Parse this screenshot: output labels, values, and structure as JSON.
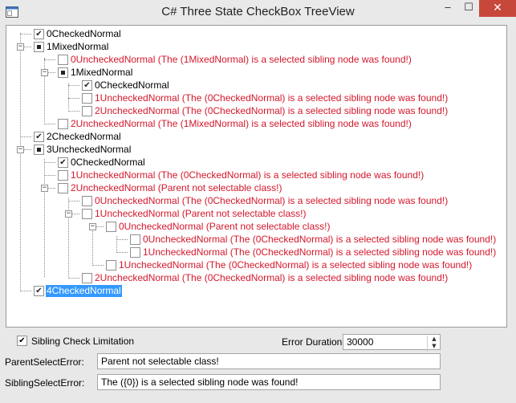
{
  "window": {
    "title": "C# Three State CheckBox TreeView",
    "icon": "app-window-icon"
  },
  "titlebar_buttons": {
    "minimize": "‒",
    "maximize": "☐",
    "close": "✕"
  },
  "tree": {
    "nodes": [
      {
        "label": "0CheckedNormal",
        "state": "checked",
        "level": 0,
        "expander": null,
        "red": false
      },
      {
        "label": "1MixedNormal",
        "state": "mixed",
        "level": 0,
        "expander": "−",
        "red": false
      },
      {
        "label": "0UncheckedNormal (The (1MixedNormal) is a selected sibling node was found!)",
        "state": "unchecked",
        "level": 1,
        "expander": null,
        "red": true
      },
      {
        "label": "1MixedNormal",
        "state": "mixed",
        "level": 1,
        "expander": "−",
        "red": false
      },
      {
        "label": "0CheckedNormal",
        "state": "checked",
        "level": 2,
        "expander": null,
        "red": false
      },
      {
        "label": "1UncheckedNormal (The (0CheckedNormal) is a selected sibling node was found!)",
        "state": "unchecked",
        "level": 2,
        "expander": null,
        "red": true
      },
      {
        "label": "2UncheckedNormal (The (0CheckedNormal) is a selected sibling node was found!)",
        "state": "unchecked",
        "level": 2,
        "expander": null,
        "red": true
      },
      {
        "label": "2UncheckedNormal (The (1MixedNormal) is a selected sibling node was found!)",
        "state": "unchecked",
        "level": 1,
        "expander": null,
        "red": true
      },
      {
        "label": "2CheckedNormal",
        "state": "checked",
        "level": 0,
        "expander": null,
        "red": false
      },
      {
        "label": "3UncheckedNormal",
        "state": "mixed",
        "level": 0,
        "expander": "−",
        "red": false
      },
      {
        "label": "0CheckedNormal",
        "state": "checked",
        "level": 1,
        "expander": null,
        "red": false
      },
      {
        "label": "1UncheckedNormal (The (0CheckedNormal) is a selected sibling node was found!)",
        "state": "unchecked",
        "level": 1,
        "expander": null,
        "red": true
      },
      {
        "label": "2UncheckedNormal (Parent not selectable class!)",
        "state": "unchecked",
        "level": 1,
        "expander": "−",
        "red": true
      },
      {
        "label": "0UncheckedNormal (The (0CheckedNormal) is a selected sibling node was found!)",
        "state": "unchecked",
        "level": 2,
        "expander": null,
        "red": true
      },
      {
        "label": "1UncheckedNormal (Parent not selectable class!)",
        "state": "unchecked",
        "level": 2,
        "expander": "−",
        "red": true
      },
      {
        "label": "0UncheckedNormal (Parent not selectable class!)",
        "state": "unchecked",
        "level": 3,
        "expander": "−",
        "red": true
      },
      {
        "label": "0UncheckedNormal (The (0CheckedNormal) is a selected sibling node was found!)",
        "state": "unchecked",
        "level": 4,
        "expander": null,
        "red": true
      },
      {
        "label": "1UncheckedNormal (The (0CheckedNormal) is a selected sibling node was found!)",
        "state": "unchecked",
        "level": 4,
        "expander": null,
        "red": true
      },
      {
        "label": "1UncheckedNormal (The (0CheckedNormal) is a selected sibling node was found!)",
        "state": "unchecked",
        "level": 3,
        "expander": null,
        "red": true
      },
      {
        "label": "2UncheckedNormal (The (0CheckedNormal) is a selected sibling node was found!)",
        "state": "unchecked",
        "level": 2,
        "expander": null,
        "red": true
      },
      {
        "label": "4CheckedNormal",
        "state": "checked",
        "level": 0,
        "expander": null,
        "red": false,
        "selected": true
      }
    ]
  },
  "controls": {
    "sibling_check_label": "Sibling Check Limitation",
    "sibling_check_checked": true,
    "error_duration_label": "Error Duration:",
    "error_duration_value": "30000",
    "parent_select_error_label": "ParentSelectError:",
    "parent_select_error_value": "Parent not selectable class!",
    "sibling_select_error_label": "SiblingSelectError:",
    "sibling_select_error_value": "The ({0}) is a selected sibling node was found!"
  },
  "colors": {
    "error_text": "#d4172b",
    "selection": "#3399ff",
    "close_button": "#c7473b"
  }
}
